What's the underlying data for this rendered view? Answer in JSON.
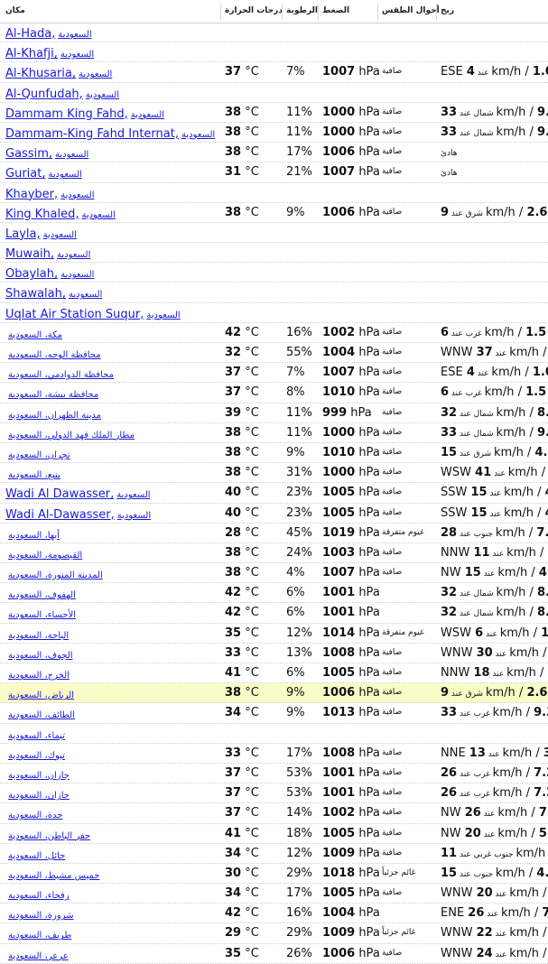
{
  "headers": {
    "place": "مكان",
    "temp": "درجات الحرارة",
    "humidity": "الرطوبة",
    "pressure": "الضغط",
    "conditions": "أحوال الطقس",
    "wind": "ريح"
  },
  "rows": [
    {
      "place": "Al-Hada,",
      "country": "السعودية",
      "temp": "",
      "temp_unit": "",
      "humidity": "",
      "pressure": "",
      "pressure_unit": "",
      "cond": "",
      "wdir": "",
      "wspeed": "",
      "wmid": "",
      "wunit": "",
      "wsec": "",
      "highlight": false
    },
    {
      "place": "Al-Khafji,",
      "country": "السعودية",
      "temp": "",
      "temp_unit": "",
      "humidity": "",
      "pressure": "",
      "pressure_unit": "",
      "cond": "",
      "wdir": "",
      "wspeed": "",
      "wmid": "",
      "wunit": "",
      "wsec": "",
      "highlight": false
    },
    {
      "place": "Al-Khusaria,",
      "country": "السعودية",
      "temp": "37",
      "temp_unit": " °C",
      "humidity": "7%",
      "pressure": "1007",
      "pressure_unit": " hPa",
      "cond": "صافية",
      "wdir": "ESE ",
      "wspeed": "4",
      "wmid": " عند ",
      "wunit": "km/h / ",
      "wsec": "1.0 m",
      "highlight": false
    },
    {
      "place": "Al-Qunfudah,",
      "country": "السعودية",
      "temp": "",
      "temp_unit": "",
      "humidity": "",
      "pressure": "",
      "pressure_unit": "",
      "cond": "",
      "wdir": "",
      "wspeed": "",
      "wmid": "",
      "wunit": "",
      "wsec": "",
      "highlight": false
    },
    {
      "place": "Dammam King Fahd,",
      "country": "السعودية",
      "temp": "38",
      "temp_unit": " °C",
      "humidity": "11%",
      "pressure": "1000",
      "pressure_unit": " hPa",
      "cond": "صافية",
      "wdir": "",
      "wspeed": "33",
      "wmid": " شمال عند ",
      "wunit": "km/h / ",
      "wsec": "9.3 m",
      "highlight": false
    },
    {
      "place": "Dammam-King Fahd Internat,",
      "country": "السعودية",
      "temp": "38",
      "temp_unit": " °C",
      "humidity": "11%",
      "pressure": "1000",
      "pressure_unit": " hPa",
      "cond": "صافية",
      "wdir": "",
      "wspeed": "33",
      "wmid": " شمال عند ",
      "wunit": "km/h / ",
      "wsec": "9.3 m",
      "highlight": false
    },
    {
      "place": "Gassim,",
      "country": "السعودية",
      "temp": "38",
      "temp_unit": " °C",
      "humidity": "17%",
      "pressure": "1006",
      "pressure_unit": " hPa",
      "cond": "صافية",
      "wdir": "",
      "wspeed": "",
      "wmid": "هادئ",
      "wunit": "",
      "wsec": "",
      "highlight": false
    },
    {
      "place": "Guriat,",
      "country": "السعودية",
      "temp": "31",
      "temp_unit": " °C",
      "humidity": "21%",
      "pressure": "1007",
      "pressure_unit": " hPa",
      "cond": "صافية",
      "wdir": "",
      "wspeed": "",
      "wmid": "هادئ",
      "wunit": "",
      "wsec": "",
      "highlight": false
    },
    {
      "place": "Khayber,",
      "country": "السعودية",
      "temp": "",
      "temp_unit": "",
      "humidity": "",
      "pressure": "",
      "pressure_unit": "",
      "cond": "",
      "wdir": "",
      "wspeed": "",
      "wmid": "",
      "wunit": "",
      "wsec": "",
      "highlight": false
    },
    {
      "place": "King Khaled,",
      "country": "السعودية",
      "temp": "38",
      "temp_unit": " °C",
      "humidity": "9%",
      "pressure": "1006",
      "pressure_unit": " hPa",
      "cond": "صافية",
      "wdir": "",
      "wspeed": "9",
      "wmid": " شرق عند ",
      "wunit": "km/h / ",
      "wsec": "2.6 m/",
      "highlight": false
    },
    {
      "place": "Layla,",
      "country": "السعودية",
      "temp": "",
      "temp_unit": "",
      "humidity": "",
      "pressure": "",
      "pressure_unit": "",
      "cond": "",
      "wdir": "",
      "wspeed": "",
      "wmid": "",
      "wunit": "",
      "wsec": "",
      "highlight": false
    },
    {
      "place": "Muwaih,",
      "country": "السعودية",
      "temp": "",
      "temp_unit": "",
      "humidity": "",
      "pressure": "",
      "pressure_unit": "",
      "cond": "",
      "wdir": "",
      "wspeed": "",
      "wmid": "",
      "wunit": "",
      "wsec": "",
      "highlight": false
    },
    {
      "place": "Obaylah,",
      "country": "السعودية",
      "temp": "",
      "temp_unit": "",
      "humidity": "",
      "pressure": "",
      "pressure_unit": "",
      "cond": "",
      "wdir": "",
      "wspeed": "",
      "wmid": "",
      "wunit": "",
      "wsec": "",
      "highlight": false
    },
    {
      "place": "Shawalah,",
      "country": "السعودية",
      "temp": "",
      "temp_unit": "",
      "humidity": "",
      "pressure": "",
      "pressure_unit": "",
      "cond": "",
      "wdir": "",
      "wspeed": "",
      "wmid": "",
      "wunit": "",
      "wsec": "",
      "highlight": false
    },
    {
      "place": "Uqlat Air Station Suqur,",
      "country": "السعودية",
      "temp": "",
      "temp_unit": "",
      "humidity": "",
      "pressure": "",
      "pressure_unit": "",
      "cond": "",
      "wdir": "",
      "wspeed": "",
      "wmid": "",
      "wunit": "",
      "wsec": "",
      "highlight": false
    },
    {
      "place": "",
      "country": "مكة، السعودية",
      "temp": "42",
      "temp_unit": " °C",
      "humidity": "16%",
      "pressure": "1002",
      "pressure_unit": " hPa",
      "cond": "صافية",
      "wdir": "",
      "wspeed": "6",
      "wmid": " غرب عند ",
      "wunit": "km/h / ",
      "wsec": "1.5 m/",
      "highlight": false
    },
    {
      "place": "",
      "country": "محافظة الوجه، السعودية",
      "temp": "32",
      "temp_unit": " °C",
      "humidity": "55%",
      "pressure": "1004",
      "pressure_unit": " hPa",
      "cond": "صافية",
      "wdir": "WNW ",
      "wspeed": "37",
      "wmid": " عند ",
      "wunit": "km/h / ",
      "wsec": "10",
      "highlight": false
    },
    {
      "place": "",
      "country": "محافظة الدوادمي، السعودية",
      "temp": "37",
      "temp_unit": " °C",
      "humidity": "7%",
      "pressure": "1007",
      "pressure_unit": " hPa",
      "cond": "صافية",
      "wdir": "ESE ",
      "wspeed": "4",
      "wmid": " عند ",
      "wunit": "km/h / ",
      "wsec": "1.0 m",
      "highlight": false
    },
    {
      "place": "",
      "country": "محافظة بيشة، السعودية",
      "temp": "37",
      "temp_unit": " °C",
      "humidity": "8%",
      "pressure": "1010",
      "pressure_unit": " hPa",
      "cond": "صافية",
      "wdir": "",
      "wspeed": "6",
      "wmid": " غرب عند ",
      "wunit": "km/h / ",
      "wsec": "1.5 m/",
      "highlight": false
    },
    {
      "place": "",
      "country": "مدينة الظهران، السعودية",
      "temp": "39",
      "temp_unit": " °C",
      "humidity": "11%",
      "pressure": "999",
      "pressure_unit": " hPa",
      "cond": "صافية",
      "wdir": "",
      "wspeed": "32",
      "wmid": " شمال عند ",
      "wunit": "km/h / ",
      "wsec": "8.7 m",
      "highlight": false
    },
    {
      "place": "",
      "country": "مطار الملك فهد الدولي، السعودية",
      "temp": "38",
      "temp_unit": " °C",
      "humidity": "11%",
      "pressure": "1000",
      "pressure_unit": " hPa",
      "cond": "صافية",
      "wdir": "",
      "wspeed": "33",
      "wmid": " شمال عند ",
      "wunit": "km/h / ",
      "wsec": "9.3 m",
      "highlight": false
    },
    {
      "place": "",
      "country": "نجران، السعودية",
      "temp": "38",
      "temp_unit": " °C",
      "humidity": "9%",
      "pressure": "1010",
      "pressure_unit": " hPa",
      "cond": "صافية",
      "wdir": "",
      "wspeed": "15",
      "wmid": " شرق عند ",
      "wunit": "km/h / ",
      "wsec": "4.1 m",
      "highlight": false
    },
    {
      "place": "",
      "country": "ينبع، السعودية",
      "temp": "38",
      "temp_unit": " °C",
      "humidity": "31%",
      "pressure": "1000",
      "pressure_unit": " hPa",
      "cond": "صافية",
      "wdir": "WSW ",
      "wspeed": "41",
      "wmid": " عند ",
      "wunit": "km/h / ",
      "wsec": "11",
      "highlight": false
    },
    {
      "place": "Wadi Al Dawasser,",
      "country": "السعودية",
      "temp": "40",
      "temp_unit": " °C",
      "humidity": "23%",
      "pressure": "1005",
      "pressure_unit": " hPa",
      "cond": "صافية",
      "wdir": "SSW ",
      "wspeed": "15",
      "wmid": " عند ",
      "wunit": "km/h / ",
      "wsec": "4.1",
      "highlight": false
    },
    {
      "place": "Wadi Al-Dawasser,",
      "country": "السعودية",
      "temp": "40",
      "temp_unit": " °C",
      "humidity": "23%",
      "pressure": "1005",
      "pressure_unit": " hPa",
      "cond": "صافية",
      "wdir": "SSW ",
      "wspeed": "15",
      "wmid": " عند ",
      "wunit": "km/h / ",
      "wsec": "4.1",
      "highlight": false
    },
    {
      "place": "",
      "country": "أبها، السعودية",
      "temp": "28",
      "temp_unit": " °C",
      "humidity": "45%",
      "pressure": "1019",
      "pressure_unit": " hPa",
      "cond": "غيوم متفرقة",
      "wdir": "",
      "wspeed": "28",
      "wmid": " جنوب عند ",
      "wunit": "km/h / ",
      "wsec": "7.7 m",
      "highlight": false
    },
    {
      "place": "",
      "country": "القيصومة، السعودية",
      "temp": "38",
      "temp_unit": " °C",
      "humidity": "24%",
      "pressure": "1003",
      "pressure_unit": " hPa",
      "cond": "صافية",
      "wdir": "NNW ",
      "wspeed": "11",
      "wmid": " عند ",
      "wunit": "km/h / ",
      "wsec": "3.1",
      "highlight": false
    },
    {
      "place": "",
      "country": "المدينة المنورة، السعودية",
      "temp": "38",
      "temp_unit": " °C",
      "humidity": "4%",
      "pressure": "1007",
      "pressure_unit": " hPa",
      "cond": "صافية",
      "wdir": "NW ",
      "wspeed": "15",
      "wmid": " عند ",
      "wunit": "km/h / ",
      "wsec": "4.1 m",
      "highlight": false
    },
    {
      "place": "",
      "country": "الهفوف، السعودية",
      "temp": "42",
      "temp_unit": " °C",
      "humidity": "6%",
      "pressure": "1001",
      "pressure_unit": " hPa",
      "cond": "",
      "wdir": "",
      "wspeed": "32",
      "wmid": " شمال عند ",
      "wunit": "km/h / ",
      "wsec": "8.7 m",
      "highlight": false
    },
    {
      "place": "",
      "country": "الأحساء، السعودية",
      "temp": "42",
      "temp_unit": " °C",
      "humidity": "6%",
      "pressure": "1001",
      "pressure_unit": " hPa",
      "cond": "",
      "wdir": "",
      "wspeed": "32",
      "wmid": " شمال عند ",
      "wunit": "km/h / ",
      "wsec": "8.7 m",
      "highlight": false
    },
    {
      "place": "",
      "country": "الباحة، السعودية",
      "temp": "35",
      "temp_unit": " °C",
      "humidity": "12%",
      "pressure": "1014",
      "pressure_unit": " hPa",
      "cond": "غيوم متفرقة",
      "wdir": "WSW ",
      "wspeed": "6",
      "wmid": " عند ",
      "wunit": "km/h / ",
      "wsec": "1.5 m",
      "highlight": false
    },
    {
      "place": "",
      "country": "الجوف، السعودية",
      "temp": "33",
      "temp_unit": " °C",
      "humidity": "13%",
      "pressure": "1008",
      "pressure_unit": " hPa",
      "cond": "صافية",
      "wdir": "WNW ",
      "wspeed": "30",
      "wmid": " عند ",
      "wunit": "km/h / ",
      "wsec": "8.2",
      "highlight": false
    },
    {
      "place": "",
      "country": "الخرج، السعودية",
      "temp": "41",
      "temp_unit": " °C",
      "humidity": "6%",
      "pressure": "1005",
      "pressure_unit": " hPa",
      "cond": "صافية",
      "wdir": "NNW ",
      "wspeed": "18",
      "wmid": " عند ",
      "wunit": "km/h / ",
      "wsec": "5.1",
      "highlight": false
    },
    {
      "place": "",
      "country": "الرياض، السعودية",
      "temp": "38",
      "temp_unit": " °C",
      "humidity": "9%",
      "pressure": "1006",
      "pressure_unit": " hPa",
      "cond": "صافية",
      "wdir": "",
      "wspeed": "9",
      "wmid": " شرق عند ",
      "wunit": "km/h / ",
      "wsec": "2.6 m",
      "highlight": true
    },
    {
      "place": "",
      "country": "الطائف، السعودية",
      "temp": "34",
      "temp_unit": " °C",
      "humidity": "9%",
      "pressure": "1013",
      "pressure_unit": " hPa",
      "cond": "صافية",
      "wdir": "",
      "wspeed": "33",
      "wmid": " غرب عند ",
      "wunit": "km/h / ",
      "wsec": "9.3 m",
      "highlight": false
    },
    {
      "place": "",
      "country": "تيماء، السعودية",
      "temp": "",
      "temp_unit": "",
      "humidity": "",
      "pressure": "",
      "pressure_unit": "",
      "cond": "",
      "wdir": "",
      "wspeed": "",
      "wmid": "",
      "wunit": "",
      "wsec": "",
      "highlight": false
    },
    {
      "place": "",
      "country": "تبوك، السعودية",
      "temp": "33",
      "temp_unit": " °C",
      "humidity": "17%",
      "pressure": "1008",
      "pressure_unit": " hPa",
      "cond": "صافية",
      "wdir": "NNE ",
      "wspeed": "13",
      "wmid": " عند ",
      "wunit": "km/h / ",
      "wsec": "3.6",
      "highlight": false
    },
    {
      "place": "",
      "country": "جازان، السعودية",
      "temp": "37",
      "temp_unit": " °C",
      "humidity": "53%",
      "pressure": "1001",
      "pressure_unit": " hPa",
      "cond": "صافية",
      "wdir": "",
      "wspeed": "26",
      "wmid": " غرب عند ",
      "wunit": "km/h / ",
      "wsec": "7.2 m",
      "highlight": false
    },
    {
      "place": "",
      "country": "جازان، السعودية",
      "temp": "37",
      "temp_unit": " °C",
      "humidity": "53%",
      "pressure": "1001",
      "pressure_unit": " hPa",
      "cond": "صافية",
      "wdir": "",
      "wspeed": "26",
      "wmid": " غرب عند ",
      "wunit": "km/h / ",
      "wsec": "7.2 m",
      "highlight": false
    },
    {
      "place": "",
      "country": "جدة، السعودية",
      "temp": "37",
      "temp_unit": " °C",
      "humidity": "14%",
      "pressure": "1002",
      "pressure_unit": " hPa",
      "cond": "صافية",
      "wdir": "NW ",
      "wspeed": "26",
      "wmid": " عند ",
      "wunit": "km/h / ",
      "wsec": "7.2 m",
      "highlight": false
    },
    {
      "place": "",
      "country": "حفر الباطن، السعودية",
      "temp": "41",
      "temp_unit": " °C",
      "humidity": "18%",
      "pressure": "1005",
      "pressure_unit": " hPa",
      "cond": "صافية",
      "wdir": "NW ",
      "wspeed": "20",
      "wmid": " عند ",
      "wunit": "km/h / ",
      "wsec": "5.7 m",
      "highlight": false
    },
    {
      "place": "",
      "country": "حائل، السعودية",
      "temp": "34",
      "temp_unit": " °C",
      "humidity": "12%",
      "pressure": "1009",
      "pressure_unit": " hPa",
      "cond": "صافية",
      "wdir": "",
      "wspeed": "11",
      "wmid": " جنوب غربي عند ",
      "wunit": "km/h /",
      "wsec": "",
      "highlight": false
    },
    {
      "place": "",
      "country": "خميس مشيط، السعودية",
      "temp": "30",
      "temp_unit": " °C",
      "humidity": "29%",
      "pressure": "1018",
      "pressure_unit": " hPa",
      "cond": "غائم جزئياً",
      "wdir": "",
      "wspeed": "15",
      "wmid": " جنوب عند ",
      "wunit": "km/h / ",
      "wsec": "4.1 m",
      "highlight": false
    },
    {
      "place": "",
      "country": "رفحاء، السعودية",
      "temp": "34",
      "temp_unit": " °C",
      "humidity": "17%",
      "pressure": "1005",
      "pressure_unit": " hPa",
      "cond": "صافية",
      "wdir": "WNW ",
      "wspeed": "20",
      "wmid": " عند ",
      "wunit": "km/h / ",
      "wsec": "5.7",
      "highlight": false
    },
    {
      "place": "",
      "country": "شرورة، السعودية",
      "temp": "42",
      "temp_unit": " °C",
      "humidity": "16%",
      "pressure": "1004",
      "pressure_unit": " hPa",
      "cond": "",
      "wdir": "ENE ",
      "wspeed": "26",
      "wmid": " عند ",
      "wunit": "km/h / ",
      "wsec": "7.2",
      "highlight": false
    },
    {
      "place": "",
      "country": "طريف، السعودية",
      "temp": "29",
      "temp_unit": " °C",
      "humidity": "29%",
      "pressure": "1009",
      "pressure_unit": " hPa",
      "cond": "غائم جزئياً",
      "wdir": "WNW ",
      "wspeed": "22",
      "wmid": " عند ",
      "wunit": "km/h / ",
      "wsec": "6.2",
      "highlight": false
    },
    {
      "place": "",
      "country": "عرعر، السعودية",
      "temp": "35",
      "temp_unit": " °C",
      "humidity": "26%",
      "pressure": "1006",
      "pressure_unit": " hPa",
      "cond": "صافية",
      "wdir": "WNW ",
      "wspeed": "24",
      "wmid": " عند ",
      "wunit": "km/h / ",
      "wsec": "6.7",
      "highlight": false
    }
  ]
}
